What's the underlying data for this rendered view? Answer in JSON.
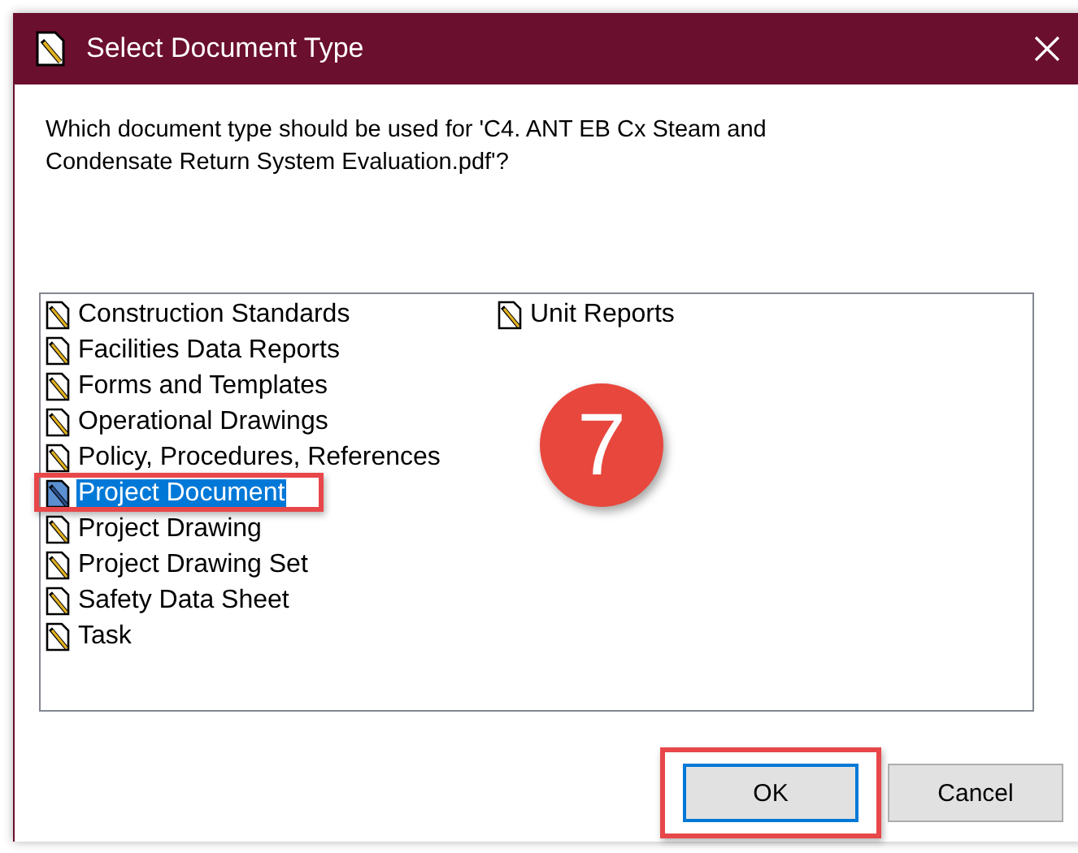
{
  "window": {
    "title": "Select Document Type"
  },
  "message": "Which document type should be used for 'C4. ANT EB Cx Steam and Condensate Return System Evaluation.pdf'?",
  "document_types": [
    [
      {
        "label": "Construction Standards",
        "selected": false,
        "highlighted": false
      },
      {
        "label": "Facilities Data Reports",
        "selected": false,
        "highlighted": false
      },
      {
        "label": "Forms and Templates",
        "selected": false,
        "highlighted": false
      },
      {
        "label": "Operational Drawings",
        "selected": false,
        "highlighted": false
      },
      {
        "label": "Policy, Procedures, References",
        "selected": false,
        "highlighted": false
      },
      {
        "label": "Project Document",
        "selected": true,
        "highlighted": true
      },
      {
        "label": "Project Drawing",
        "selected": false,
        "highlighted": false
      },
      {
        "label": "Project Drawing Set",
        "selected": false,
        "highlighted": false
      },
      {
        "label": "Safety Data Sheet",
        "selected": false,
        "highlighted": false
      },
      {
        "label": "Task",
        "selected": false,
        "highlighted": false
      }
    ],
    [
      {
        "label": "Unit Reports",
        "selected": false,
        "highlighted": false
      }
    ]
  ],
  "step_badge": "7",
  "buttons": [
    {
      "label": "OK",
      "default": true,
      "highlighted": true
    },
    {
      "label": "Cancel",
      "default": false,
      "highlighted": false
    }
  ]
}
